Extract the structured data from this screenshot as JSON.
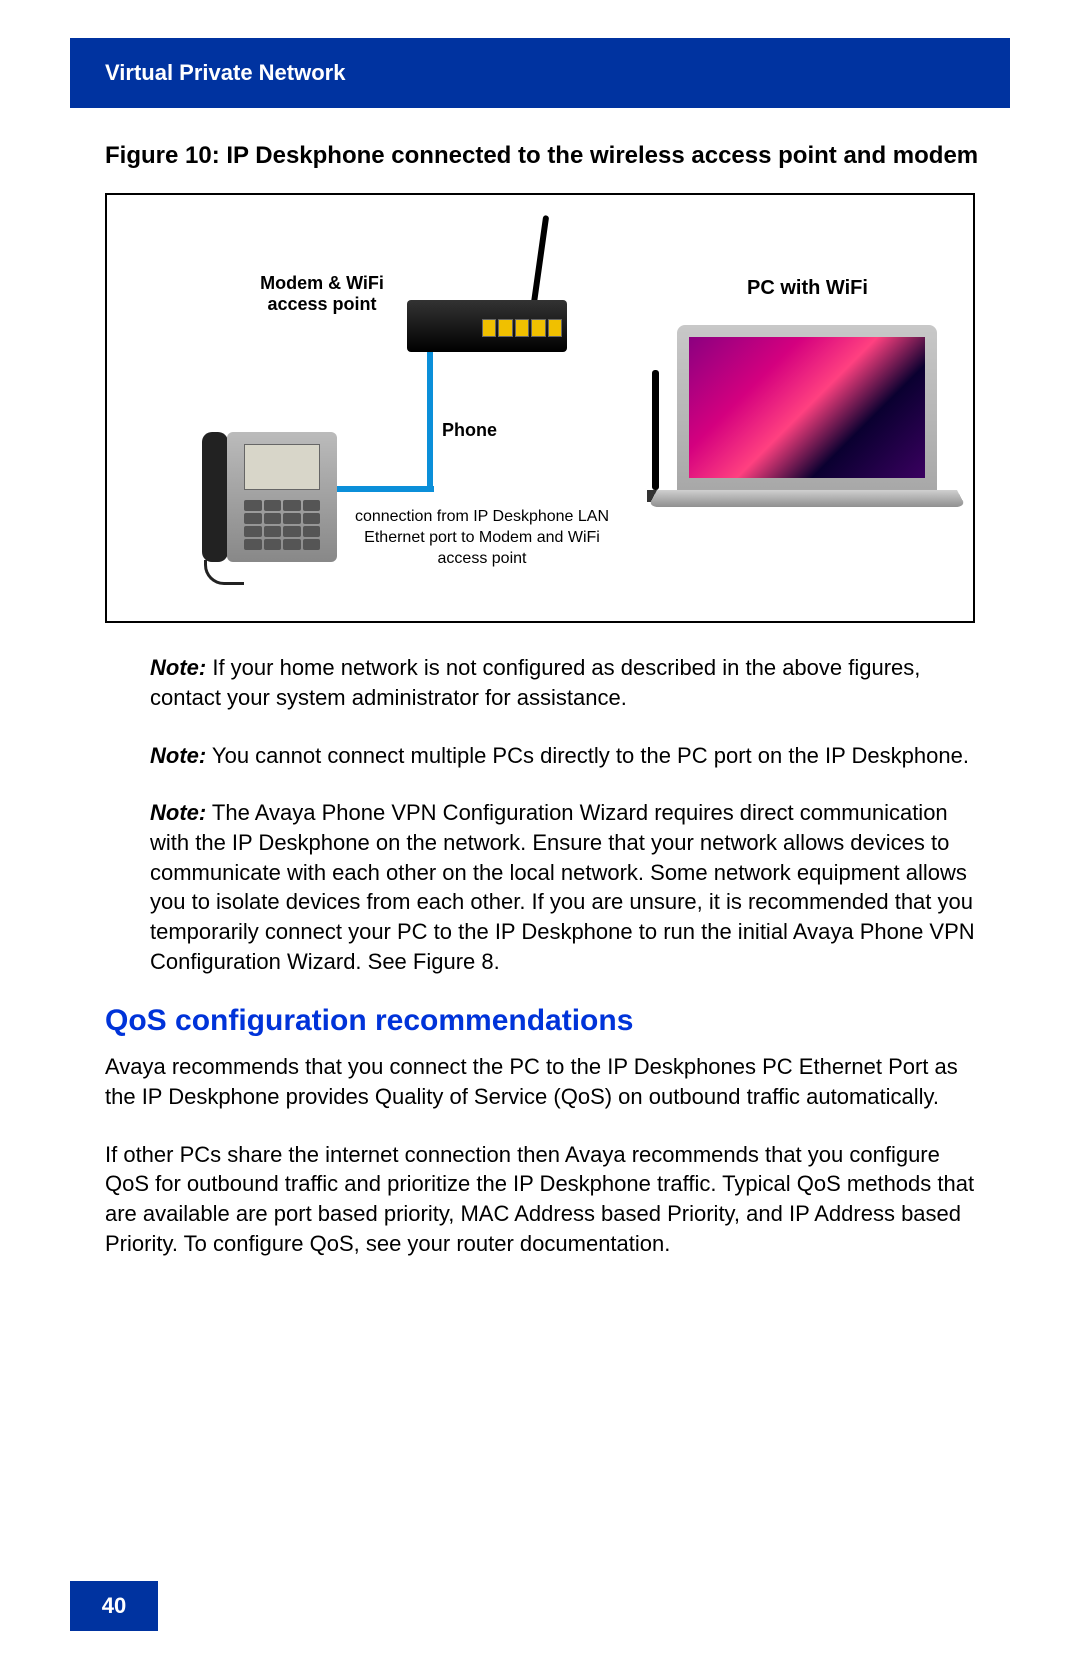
{
  "header": {
    "title": "Virtual Private Network"
  },
  "figure": {
    "caption": "Figure 10: IP Deskphone connected to the wireless access point and modem",
    "labels": {
      "modem": "Modem & WiFi access point",
      "phone": "Phone",
      "pc": "PC with WiFi",
      "connection": "connection from IP Deskphone LAN Ethernet port to Modem and WiFi access point"
    }
  },
  "notes": [
    {
      "label": "Note:",
      "text": " If your home network is not configured as described in the above figures, contact your system administrator for assistance."
    },
    {
      "label": "Note:",
      "text": " You cannot connect multiple PCs directly to the PC port on the IP Deskphone."
    },
    {
      "label": "Note:",
      "text": " The Avaya Phone VPN Configuration Wizard requires direct communication with the IP Deskphone on the network. Ensure that your network allows devices to communicate with each other on the local network. Some network equipment allows you to isolate devices from each other. If you are unsure, it is recommended that you temporarily connect your PC to the IP Deskphone to run the initial Avaya Phone VPN Configuration Wizard. See Figure 8."
    }
  ],
  "section": {
    "heading": "QoS configuration recommendations",
    "paragraphs": [
      "Avaya recommends that you connect the PC to the IP Deskphones PC Ethernet Port as the IP Deskphone provides Quality of Service (QoS) on outbound traffic automatically.",
      "If other PCs share the internet connection then Avaya recommends that you configure QoS for outbound traffic and prioritize the IP Deskphone traffic. Typical QoS methods that are available are port based priority, MAC Address based Priority, and IP Address based Priority. To configure QoS, see your router documentation."
    ]
  },
  "footer": {
    "page_number": "40"
  }
}
